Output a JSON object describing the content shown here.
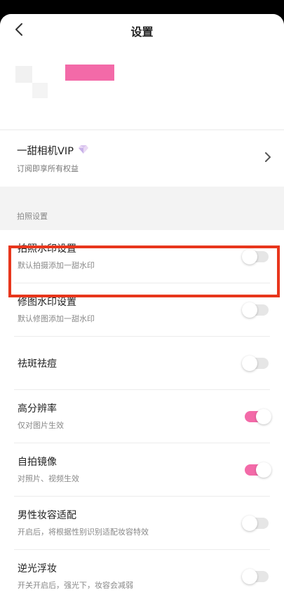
{
  "header": {
    "title": "设置"
  },
  "vip": {
    "title": "一甜相机VIP",
    "subtitle": "订阅即享所有权益"
  },
  "section": {
    "label": "拍照设置"
  },
  "settings": [
    {
      "title": "拍照水印设置",
      "subtitle": "默认拍摄添加一甜水印",
      "enabled": false
    },
    {
      "title": "修图水印设置",
      "subtitle": "默认修图添加一甜水印",
      "enabled": false
    },
    {
      "title": "祛斑祛痘",
      "subtitle": "",
      "enabled": false
    },
    {
      "title": "高分辨率",
      "subtitle": "仅对图片生效",
      "enabled": true
    },
    {
      "title": "自拍镜像",
      "subtitle": "对照片、视频生效",
      "enabled": true
    },
    {
      "title": "男性妆容适配",
      "subtitle": "开启后，将根据性别识别适配妆容特效",
      "enabled": false
    },
    {
      "title": "逆光浮妆",
      "subtitle": "开关开启后，强光下，妆容会减弱",
      "enabled": false
    }
  ],
  "colors": {
    "accent": "#f36aa8",
    "highlight": "#e8361c"
  }
}
